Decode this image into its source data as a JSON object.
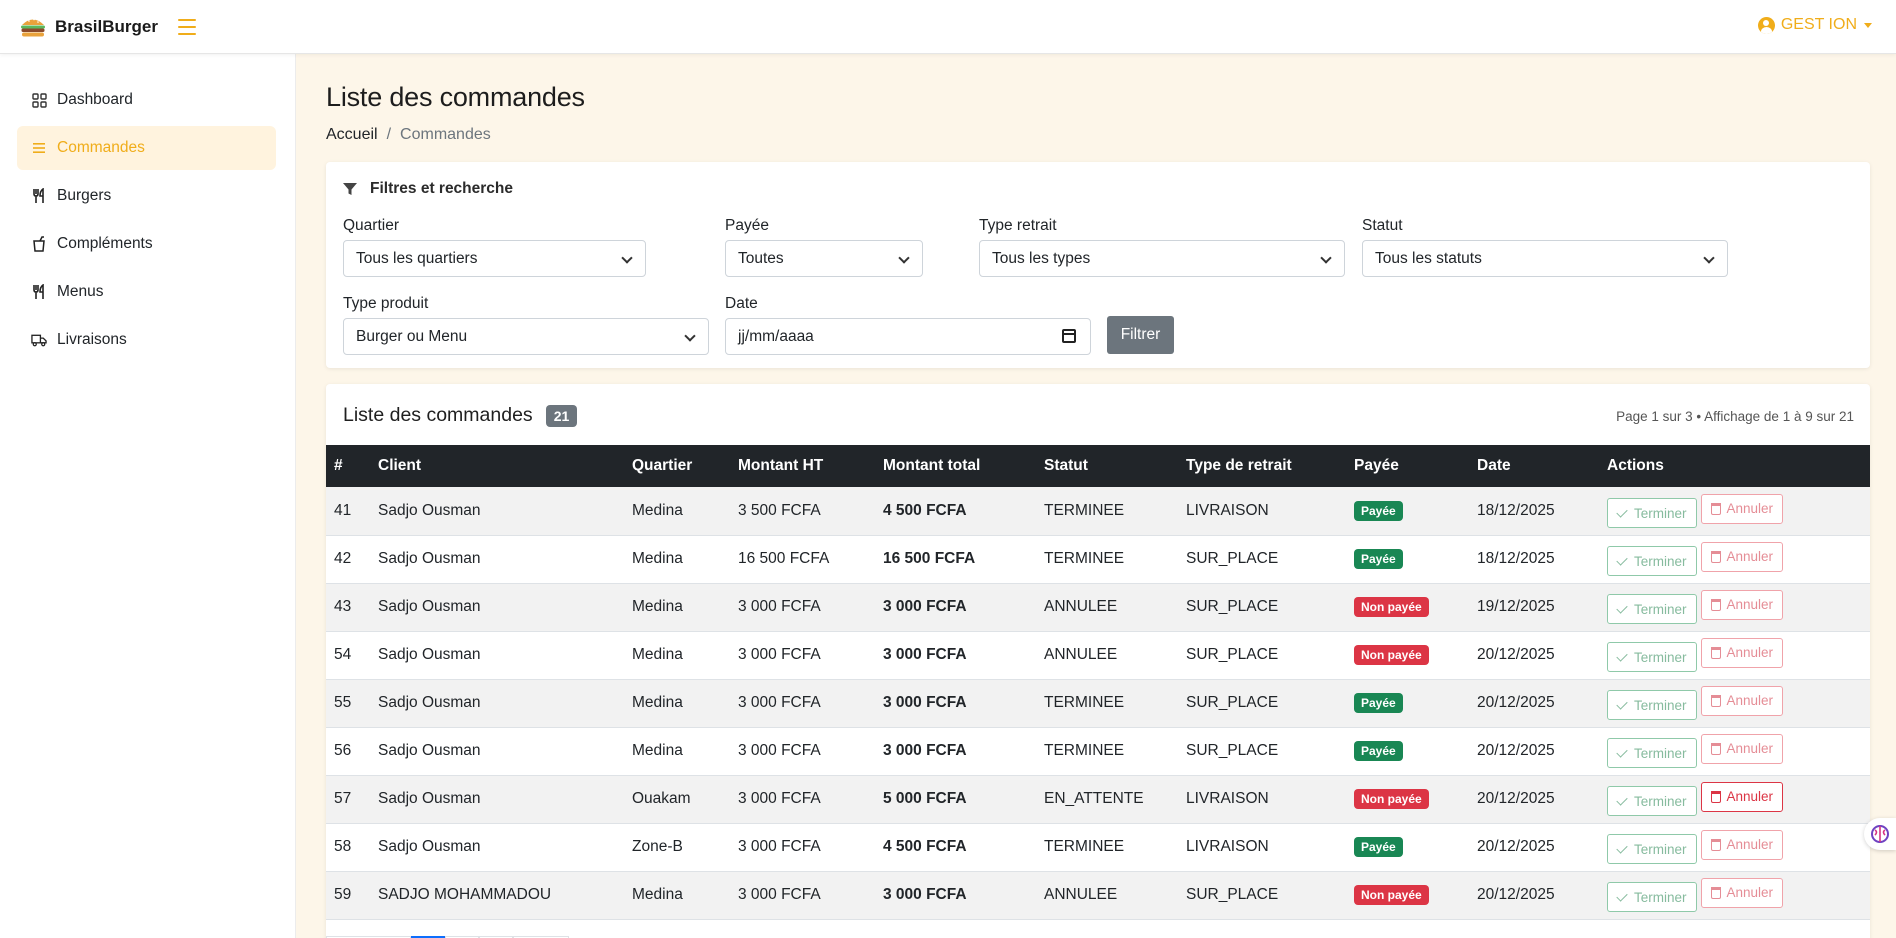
{
  "brand": {
    "name": "BrasilBurger"
  },
  "user_menu": {
    "label": "GEST ION"
  },
  "sidebar": {
    "items": [
      {
        "label": "Dashboard",
        "icon": "grid-icon"
      },
      {
        "label": "Commandes",
        "icon": "list-icon",
        "active": true
      },
      {
        "label": "Burgers",
        "icon": "utensils-icon"
      },
      {
        "label": "Compléments",
        "icon": "cup-icon"
      },
      {
        "label": "Menus",
        "icon": "utensils-icon"
      },
      {
        "label": "Livraisons",
        "icon": "truck-icon"
      }
    ]
  },
  "page": {
    "title": "Liste des commandes",
    "breadcrumb": {
      "home": "Accueil",
      "separator": "/",
      "current": "Commandes"
    }
  },
  "filters": {
    "heading": "Filtres et recherche",
    "quartier": {
      "label": "Quartier",
      "value": "Tous les quartiers"
    },
    "payee": {
      "label": "Payée",
      "value": "Toutes"
    },
    "type_retrait": {
      "label": "Type retrait",
      "value": "Tous les types"
    },
    "statut": {
      "label": "Statut",
      "value": "Tous les statuts"
    },
    "type_produit": {
      "label": "Type produit",
      "value": "Burger ou Menu"
    },
    "date": {
      "label": "Date",
      "placeholder": "jj/mm/aaaa"
    },
    "submit_label": "Filtrer"
  },
  "orders": {
    "title": "Liste des commandes",
    "count": "21",
    "page_info": "Page 1 sur 3 • Affichage de 1 à 9 sur 21",
    "columns": [
      "#",
      "Client",
      "Quartier",
      "Montant HT",
      "Montant total",
      "Statut",
      "Type de retrait",
      "Payée",
      "Date",
      "Actions"
    ],
    "action_labels": {
      "finish": "Terminer",
      "cancel": "Annuler"
    },
    "rows": [
      {
        "id": "41",
        "client": "Sadjo Ousman",
        "quartier": "Medina",
        "ht": "3 500 FCFA",
        "total": "4 500 FCFA",
        "statut": "TERMINEE",
        "retrait": "LIVRAISON",
        "payee": "Payée",
        "paid": true,
        "date": "18/12/2025"
      },
      {
        "id": "42",
        "client": "Sadjo Ousman",
        "quartier": "Medina",
        "ht": "16 500 FCFA",
        "total": "16 500 FCFA",
        "statut": "TERMINEE",
        "retrait": "SUR_PLACE",
        "payee": "Payée",
        "paid": true,
        "date": "18/12/2025"
      },
      {
        "id": "43",
        "client": "Sadjo Ousman",
        "quartier": "Medina",
        "ht": "3 000 FCFA",
        "total": "3 000 FCFA",
        "statut": "ANNULEE",
        "retrait": "SUR_PLACE",
        "payee": "Non payée",
        "paid": false,
        "date": "19/12/2025"
      },
      {
        "id": "54",
        "client": "Sadjo Ousman",
        "quartier": "Medina",
        "ht": "3 000 FCFA",
        "total": "3 000 FCFA",
        "statut": "ANNULEE",
        "retrait": "SUR_PLACE",
        "payee": "Non payée",
        "paid": false,
        "date": "20/12/2025"
      },
      {
        "id": "55",
        "client": "Sadjo Ousman",
        "quartier": "Medina",
        "ht": "3 000 FCFA",
        "total": "3 000 FCFA",
        "statut": "TERMINEE",
        "retrait": "SUR_PLACE",
        "payee": "Payée",
        "paid": true,
        "date": "20/12/2025"
      },
      {
        "id": "56",
        "client": "Sadjo Ousman",
        "quartier": "Medina",
        "ht": "3 000 FCFA",
        "total": "3 000 FCFA",
        "statut": "TERMINEE",
        "retrait": "SUR_PLACE",
        "payee": "Payée",
        "paid": true,
        "date": "20/12/2025"
      },
      {
        "id": "57",
        "client": "Sadjo Ousman",
        "quartier": "Ouakam",
        "ht": "3 000 FCFA",
        "total": "5 000 FCFA",
        "statut": "EN_ATTENTE",
        "retrait": "LIVRAISON",
        "payee": "Non payée",
        "paid": false,
        "date": "20/12/2025"
      },
      {
        "id": "58",
        "client": "Sadjo Ousman",
        "quartier": "Zone-B",
        "ht": "3 000 FCFA",
        "total": "4 500 FCFA",
        "statut": "TERMINEE",
        "retrait": "LIVRAISON",
        "payee": "Payée",
        "paid": true,
        "date": "20/12/2025"
      },
      {
        "id": "59",
        "client": "SADJO MOHAMMADOU",
        "quartier": "Medina",
        "ht": "3 000 FCFA",
        "total": "3 000 FCFA",
        "statut": "ANNULEE",
        "retrait": "SUR_PLACE",
        "payee": "Non payée",
        "paid": false,
        "date": "20/12/2025"
      }
    ]
  },
  "colors": {
    "accent": "#f0ad1a",
    "paid": "#198754",
    "unpaid": "#dc3545",
    "table_header": "#212529",
    "page_bg": "#fdf6e9"
  }
}
